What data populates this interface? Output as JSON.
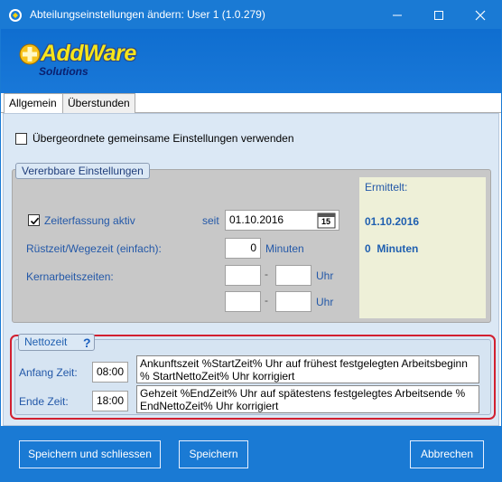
{
  "window": {
    "title": "Abteilungseinstellungen ändern: User 1 (1.0.279)",
    "accent_color": "#1a7ad4"
  },
  "logo": {
    "name": "AddWare",
    "sub": "Solutions"
  },
  "tabs": [
    {
      "label": "Allgemein",
      "active": true
    },
    {
      "label": "Überstunden",
      "active": false
    }
  ],
  "general": {
    "use_parent_label": "Übergeordnete gemeinsame Einstellungen verwenden",
    "use_parent_checked": false
  },
  "inherited": {
    "group_title": "Vererbbare Einstellungen",
    "time_tracking_label": "Zeiterfassung aktiv",
    "time_tracking_checked": true,
    "since_label": "seit",
    "since_value": "01.10.2016",
    "calendar_day": "15",
    "setup_label": "Rüstzeit/Wegezeit (einfach):",
    "setup_value": "0",
    "minutes_label": "Minuten",
    "core_label": "Kernarbeitszeiten:",
    "core_rows": [
      {
        "from": "",
        "dash": "-",
        "to": "",
        "unit": "Uhr"
      },
      {
        "from": "",
        "dash": "-",
        "to": "",
        "unit": "Uhr"
      }
    ]
  },
  "ermittelt": {
    "title": "Ermittelt:",
    "date": "01.10.2016",
    "minutes": "0  Minuten"
  },
  "netto": {
    "group_title": "Nettozeit",
    "help": "?",
    "start_label": "Anfang Zeit:",
    "start_value": "08:00",
    "start_desc": "Ankunftszeit %StartZeit% Uhr auf frühest festgelegten Arbeitsbeginn % StartNettoZeit% Uhr korrigiert",
    "end_label": "Ende Zeit:",
    "end_value": "18:00",
    "end_desc": "Gehzeit %EndZeit% Uhr auf spätestens festgelegtes Arbeitsende % EndNettoZeit% Uhr korrigiert",
    "highlight_color": "#d22030"
  },
  "footer": {
    "save_close": "Speichern und schliessen",
    "save": "Speichern",
    "cancel": "Abbrechen"
  }
}
